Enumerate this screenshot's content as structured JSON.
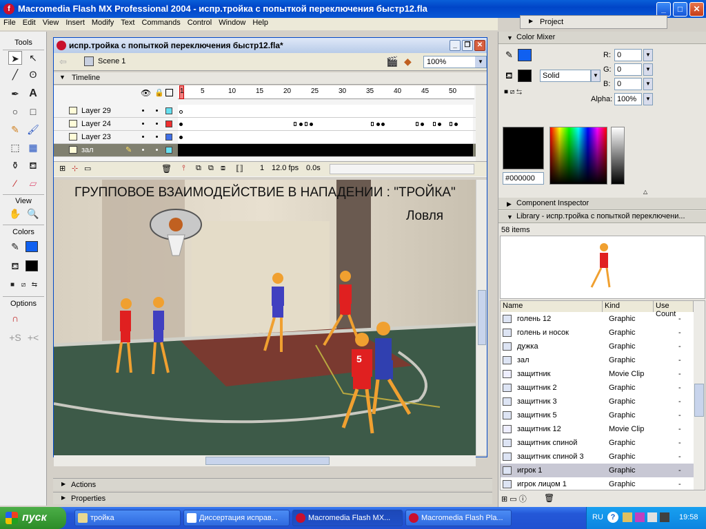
{
  "app": {
    "title": "Macromedia Flash MX Professional 2004 - испр.тройка с попыткой переключения быстр12.fla",
    "menu": [
      "File",
      "Edit",
      "View",
      "Insert",
      "Modify",
      "Text",
      "Commands",
      "Control",
      "Window",
      "Help"
    ]
  },
  "tools": {
    "header": "Tools",
    "view_label": "View",
    "colors_label": "Colors",
    "options_label": "Options"
  },
  "document": {
    "title": "испр.тройка с попыткой переключения быстр12.fla*",
    "scene": "Scene 1",
    "zoom": "100%",
    "timeline_label": "Timeline",
    "ruler": [
      "1",
      "5",
      "10",
      "15",
      "20",
      "25",
      "30",
      "35",
      "40",
      "45",
      "50"
    ],
    "layers": [
      {
        "name": "Layer 29",
        "color": "#66e0f0"
      },
      {
        "name": "Layer 24",
        "color": "#f03030"
      },
      {
        "name": "Layer 23",
        "color": "#4070e8"
      },
      {
        "name": "зал",
        "color": "#66e0f0"
      }
    ],
    "status": {
      "frame": "1",
      "fps": "12.0 fps",
      "time": "0.0s"
    }
  },
  "stage": {
    "heading": "ГРУППОВОЕ ВЗАИМОДЕЙСТВИЕ В НАПАДЕНИИ : \"ТРОЙКА\"",
    "subheading": "Ловля",
    "jersey_number": "5"
  },
  "bottom_panels": {
    "actions": "Actions",
    "properties": "Properties"
  },
  "right": {
    "project": "Project",
    "color_mixer": "Color Mixer",
    "fill_type": "Solid",
    "r_label": "R:",
    "g_label": "G:",
    "b_label": "B:",
    "alpha_label": "Alpha:",
    "r": "0",
    "g": "0",
    "b": "0",
    "alpha": "100%",
    "hex": "#000000",
    "stroke_color": "#1060f0",
    "fill_color": "#000000",
    "component_inspector": "Component Inspector",
    "library_title": "Library - испр.тройка с попыткой переключени...",
    "items_count": "58 items",
    "columns": [
      "Name",
      "Kind",
      "Use Count"
    ],
    "items": [
      {
        "name": "голень 12",
        "kind": "Graphic",
        "use": "-"
      },
      {
        "name": "голень и носок",
        "kind": "Graphic",
        "use": "-"
      },
      {
        "name": "дужка",
        "kind": "Graphic",
        "use": "-"
      },
      {
        "name": "зал",
        "kind": "Graphic",
        "use": "-"
      },
      {
        "name": "защитник",
        "kind": "Movie Clip",
        "use": "-"
      },
      {
        "name": "защитник 2",
        "kind": "Graphic",
        "use": "-"
      },
      {
        "name": "защитник 3",
        "kind": "Graphic",
        "use": "-"
      },
      {
        "name": "защитник 5",
        "kind": "Graphic",
        "use": "-"
      },
      {
        "name": "защитник 12",
        "kind": "Movie Clip",
        "use": "-"
      },
      {
        "name": "защитник спиной",
        "kind": "Graphic",
        "use": "-"
      },
      {
        "name": "защитник спиной 3",
        "kind": "Graphic",
        "use": "-"
      },
      {
        "name": "игрок 1",
        "kind": "Graphic",
        "use": "-"
      },
      {
        "name": "игрок лицом 1",
        "kind": "Graphic",
        "use": "-"
      }
    ]
  },
  "taskbar": {
    "start": "пуск",
    "tasks": [
      "тройка",
      "Диссертация исправ...",
      "Macromedia Flash MX...",
      "Macromedia Flash Pla..."
    ],
    "lang": "RU",
    "clock": "19:58"
  }
}
